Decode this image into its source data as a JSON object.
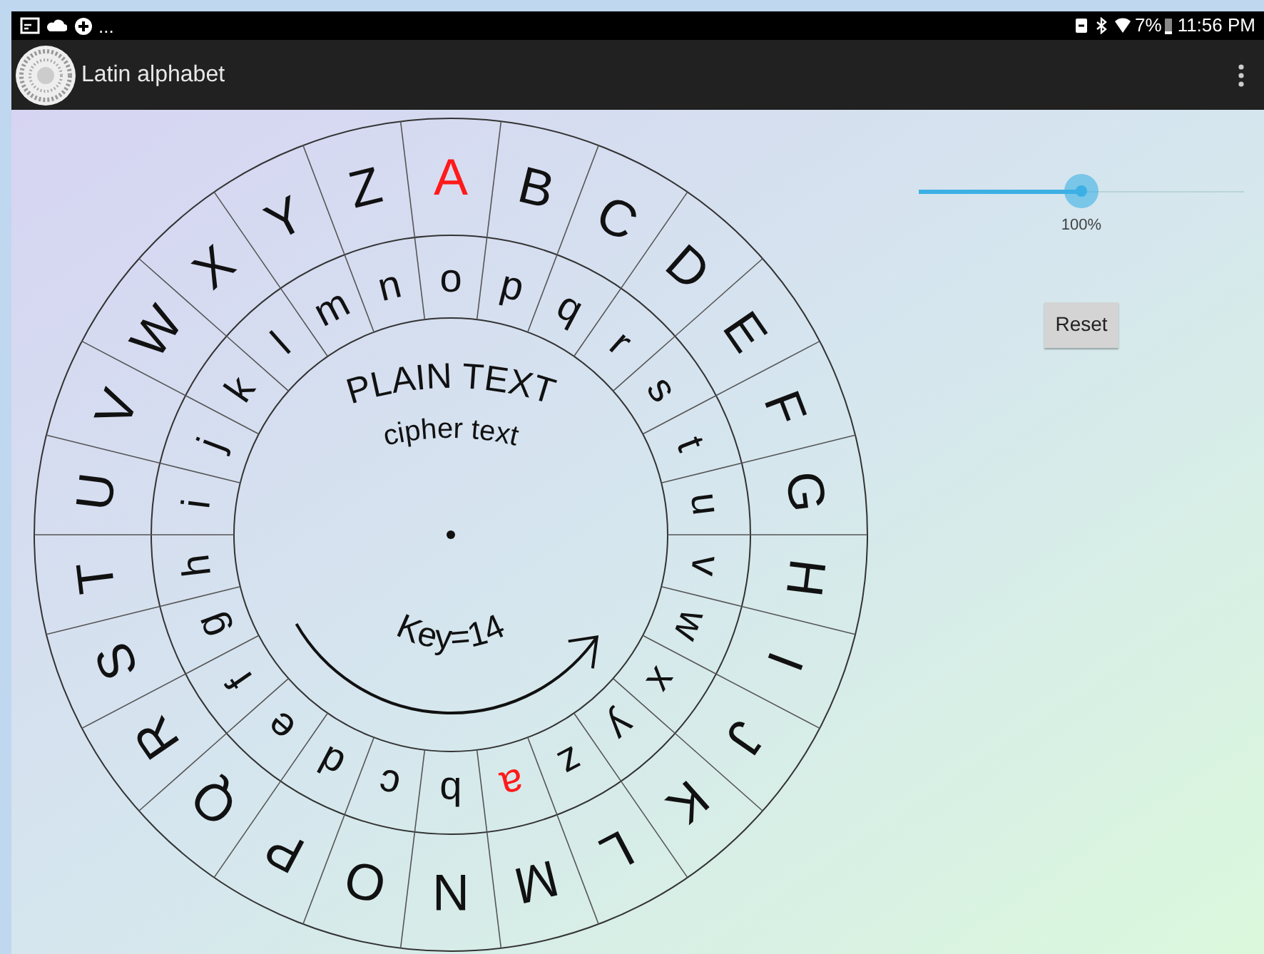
{
  "status_bar": {
    "more": "...",
    "battery": "7%",
    "time": "11:56 PM"
  },
  "app_bar": {
    "title": "Latin alphabet"
  },
  "wheel": {
    "outer_letters": [
      {
        "letter": "A",
        "highlighted": true
      },
      {
        "letter": "B",
        "highlighted": false
      },
      {
        "letter": "C",
        "highlighted": false
      },
      {
        "letter": "D",
        "highlighted": false
      },
      {
        "letter": "E",
        "highlighted": false
      },
      {
        "letter": "F",
        "highlighted": false
      },
      {
        "letter": "G",
        "highlighted": false
      },
      {
        "letter": "H",
        "highlighted": false
      },
      {
        "letter": "I",
        "highlighted": false
      },
      {
        "letter": "J",
        "highlighted": false
      },
      {
        "letter": "K",
        "highlighted": false
      },
      {
        "letter": "L",
        "highlighted": false
      },
      {
        "letter": "M",
        "highlighted": false
      },
      {
        "letter": "N",
        "highlighted": false
      },
      {
        "letter": "O",
        "highlighted": false
      },
      {
        "letter": "P",
        "highlighted": false
      },
      {
        "letter": "Q",
        "highlighted": false
      },
      {
        "letter": "R",
        "highlighted": false
      },
      {
        "letter": "S",
        "highlighted": false
      },
      {
        "letter": "T",
        "highlighted": false
      },
      {
        "letter": "U",
        "highlighted": false
      },
      {
        "letter": "V",
        "highlighted": false
      },
      {
        "letter": "W",
        "highlighted": false
      },
      {
        "letter": "X",
        "highlighted": false
      },
      {
        "letter": "Y",
        "highlighted": false
      },
      {
        "letter": "Z",
        "highlighted": false
      }
    ],
    "inner_letters": [
      {
        "letter": "o",
        "highlighted": false
      },
      {
        "letter": "p",
        "highlighted": false
      },
      {
        "letter": "q",
        "highlighted": false
      },
      {
        "letter": "r",
        "highlighted": false
      },
      {
        "letter": "s",
        "highlighted": false
      },
      {
        "letter": "t",
        "highlighted": false
      },
      {
        "letter": "u",
        "highlighted": false
      },
      {
        "letter": "v",
        "highlighted": false
      },
      {
        "letter": "w",
        "highlighted": false
      },
      {
        "letter": "x",
        "highlighted": false
      },
      {
        "letter": "y",
        "highlighted": false
      },
      {
        "letter": "z",
        "highlighted": false
      },
      {
        "letter": "a",
        "highlighted": true
      },
      {
        "letter": "b",
        "highlighted": false
      },
      {
        "letter": "c",
        "highlighted": false
      },
      {
        "letter": "d",
        "highlighted": false
      },
      {
        "letter": "e",
        "highlighted": false
      },
      {
        "letter": "f",
        "highlighted": false
      },
      {
        "letter": "g",
        "highlighted": false
      },
      {
        "letter": "h",
        "highlighted": false
      },
      {
        "letter": "i",
        "highlighted": false
      },
      {
        "letter": "j",
        "highlighted": false
      },
      {
        "letter": "k",
        "highlighted": false
      },
      {
        "letter": "l",
        "highlighted": false
      },
      {
        "letter": "m",
        "highlighted": false
      },
      {
        "letter": "n",
        "highlighted": false
      }
    ],
    "plain_label": "PLAIN TEXT",
    "cipher_label": "cipher text",
    "key_label": "Key=14"
  },
  "zoom_slider": {
    "level": 0.5,
    "reading": "100%"
  },
  "reset_button": "Reset"
}
